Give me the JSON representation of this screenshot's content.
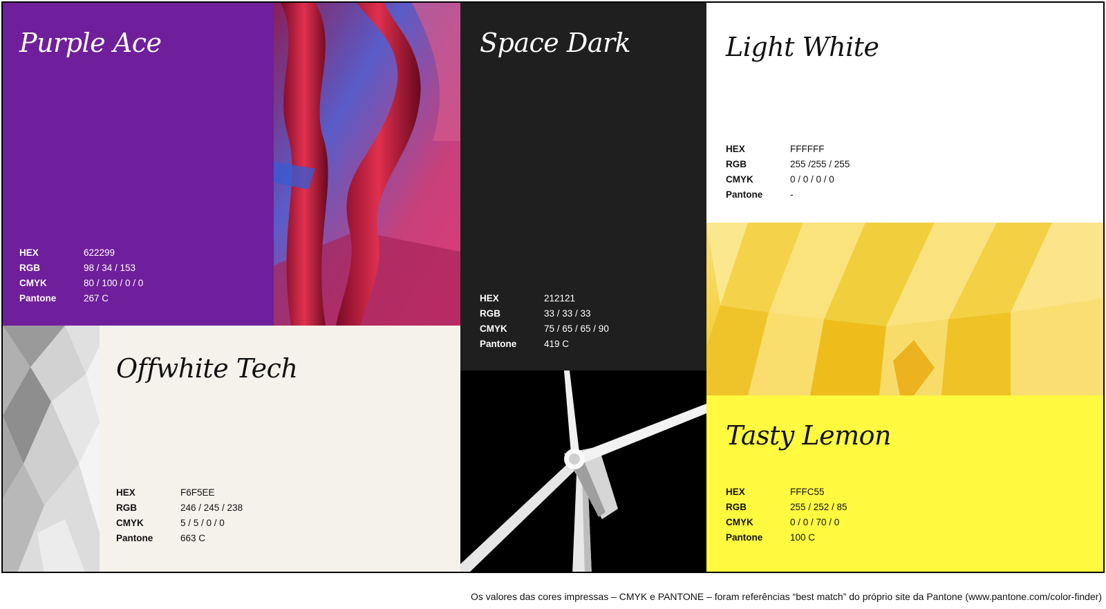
{
  "swatches": [
    {
      "name": "Purple Ace",
      "hex": "622299",
      "rgb": "98 / 34 / 153",
      "cmyk": "80 / 100 / 0 / 0",
      "pantone": "267 C",
      "color": "#6f1f9b",
      "text_color": "#ffffff"
    },
    {
      "name": "Space Dark",
      "hex": "212121",
      "rgb": "33 / 33 / 33",
      "cmyk": "75 / 65 / 65 / 90",
      "pantone": "419 C",
      "color": "#1f1f1f",
      "text_color": "#ffffff"
    },
    {
      "name": "Light White",
      "hex": "FFFFFF",
      "rgb": "255 /255 / 255",
      "cmyk": "0 / 0 / 0 / 0",
      "pantone": "-",
      "color": "#ffffff",
      "text_color": "#111111"
    },
    {
      "name": "Offwhite Tech",
      "hex": "F6F5EE",
      "rgb": "246 / 245 / 238",
      "cmyk": "5 / 5 / 0 / 0",
      "pantone": "663 C",
      "color": "#f5f2ec",
      "text_color": "#111111"
    },
    {
      "name": "Tasty Lemon",
      "hex": "FFFC55",
      "rgb": "255 / 252 / 85",
      "cmyk": "0 / 0 / 70 / 0",
      "pantone": "100 C",
      "color": "#fff93f",
      "text_color": "#111111"
    }
  ],
  "spec_labels": {
    "hex": "HEX",
    "rgb": "RGB",
    "cmyk": "CMYK",
    "pantone": "Pantone"
  },
  "photos": {
    "abstract_red": "abstract-red-blue-photo",
    "wind_turbine": "wind-turbine-photo",
    "gray_polygons": "gray-polygon-photo",
    "yellow_paper": "yellow-paper-folds-photo"
  },
  "footnote": "Os valores das cores impressas – CMYK e PANTONE – foram referências “best match” do próprio site da Pantone (www.pantone.com/color-finder)"
}
